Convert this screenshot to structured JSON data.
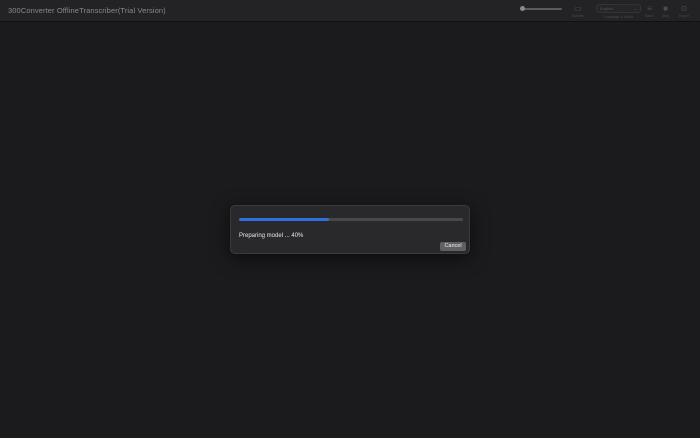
{
  "window": {
    "title": "300Converter OfflineTranscriber(Trial Version)"
  },
  "toolbar": {
    "subtitles": {
      "label": "Subtitle",
      "icon": "subtitle-icon"
    },
    "language": {
      "value": "English",
      "label": "Language & Model"
    },
    "batch": {
      "label": "Batch",
      "icon": "batch-icon"
    },
    "stop": {
      "label": "Stop",
      "icon": "stop-icon"
    },
    "export": {
      "label": "Export",
      "icon": "export-icon"
    }
  },
  "dialog": {
    "status_text": "Preparing model ... 40%",
    "progress": 0.4,
    "cancel_label": "Cancel"
  },
  "colors": {
    "background": "#1b1b1d",
    "titlebar": "#232325",
    "dialog": "#29292c",
    "progress_fill": "#2f6fe0",
    "progress_track": "#48484b",
    "cancel_button": "#606064"
  }
}
